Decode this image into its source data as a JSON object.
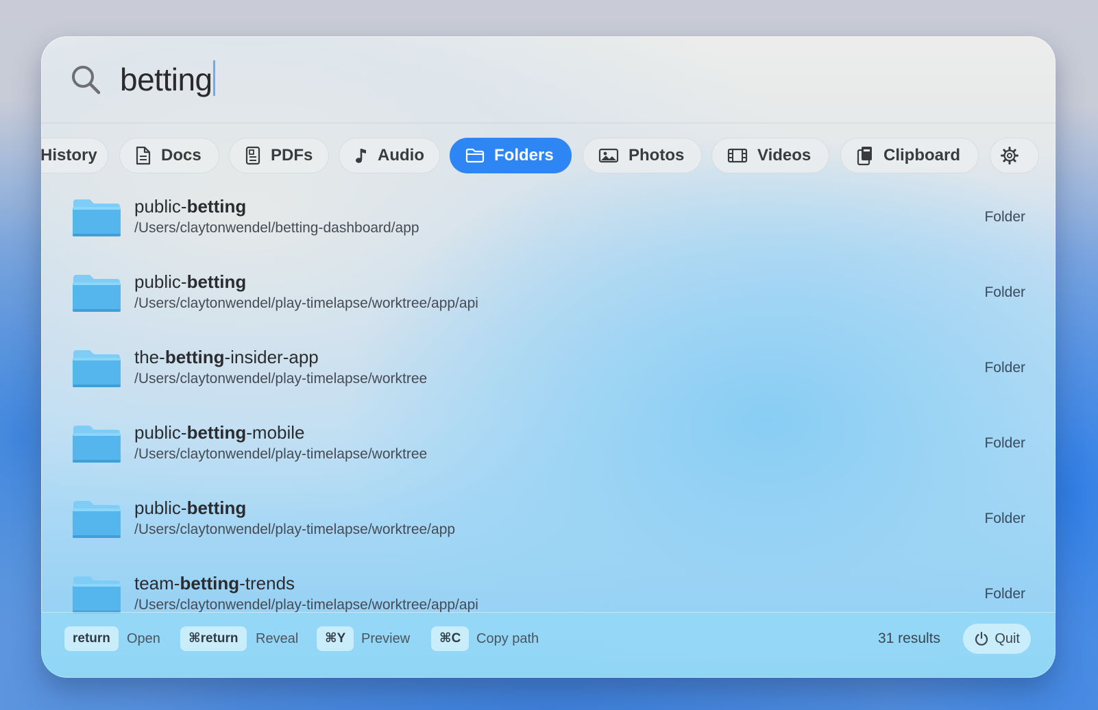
{
  "search": {
    "query": "betting"
  },
  "filters": [
    {
      "id": "history",
      "label": "History",
      "icon": "history-icon"
    },
    {
      "id": "docs",
      "label": "Docs",
      "icon": "document-icon"
    },
    {
      "id": "pdfs",
      "label": "PDFs",
      "icon": "pdf-icon"
    },
    {
      "id": "audio",
      "label": "Audio",
      "icon": "music-note-icon"
    },
    {
      "id": "folders",
      "label": "Folders",
      "icon": "folder-icon",
      "active": true
    },
    {
      "id": "photos",
      "label": "Photos",
      "icon": "photo-icon"
    },
    {
      "id": "videos",
      "label": "Videos",
      "icon": "film-icon"
    },
    {
      "id": "clipboard",
      "label": "Clipboard",
      "icon": "clipboard-icon"
    },
    {
      "id": "settings",
      "label": "",
      "icon": "gear-icon"
    }
  ],
  "results": [
    {
      "name_pre": "public-",
      "name_match": "betting",
      "name_post": "",
      "path": "/Users/claytonwendel/betting-dashboard/app",
      "kind": "Folder"
    },
    {
      "name_pre": "public-",
      "name_match": "betting",
      "name_post": "",
      "path": "/Users/claytonwendel/play-timelapse/worktree/app/api",
      "kind": "Folder"
    },
    {
      "name_pre": "the-",
      "name_match": "betting",
      "name_post": "-insider-app",
      "path": "/Users/claytonwendel/play-timelapse/worktree",
      "kind": "Folder"
    },
    {
      "name_pre": "public-",
      "name_match": "betting",
      "name_post": "-mobile",
      "path": "/Users/claytonwendel/play-timelapse/worktree",
      "kind": "Folder"
    },
    {
      "name_pre": "public-",
      "name_match": "betting",
      "name_post": "",
      "path": "/Users/claytonwendel/play-timelapse/worktree/app",
      "kind": "Folder"
    },
    {
      "name_pre": "team-",
      "name_match": "betting",
      "name_post": "-trends",
      "path": "/Users/claytonwendel/play-timelapse/worktree/app/api",
      "kind": "Folder"
    }
  ],
  "footer": {
    "shortcuts": [
      {
        "key": "return",
        "label": "Open"
      },
      {
        "key": "⌘return",
        "label": "Reveal"
      },
      {
        "key": "⌘Y",
        "label": "Preview"
      },
      {
        "key": "⌘C",
        "label": "Copy path"
      }
    ],
    "results_count": "31 results",
    "quit_label": "Quit"
  },
  "colors": {
    "accent": "#2d86f3",
    "folder_top": "#7fcdf6",
    "folder_body": "#55b6ee"
  }
}
